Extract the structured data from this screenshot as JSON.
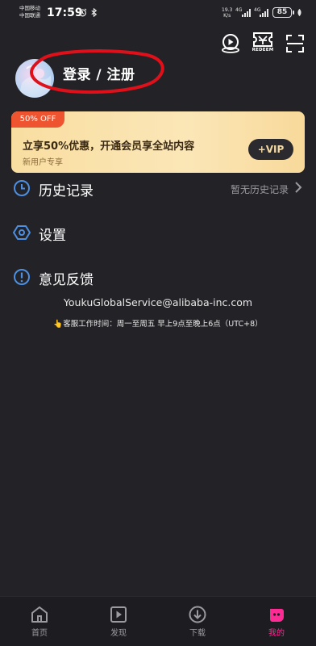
{
  "status_bar": {
    "carrier_1": "中国移动",
    "carrier_2": "中国联通",
    "time": "17:59",
    "net_speed_value": "19.3",
    "net_speed_unit": "K/s",
    "net_type_1": "4G",
    "net_type_2": "4G",
    "battery": "85"
  },
  "header": {
    "redeem_label": "REDEEM"
  },
  "profile": {
    "login_title": "登录 / 注册"
  },
  "vip_banner": {
    "badge": "50% OFF",
    "title": "立享50%优惠，开通会员享全站内容",
    "subtitle": "新用户专享",
    "button": "+VIP"
  },
  "menu": {
    "history_label": "历史记录",
    "history_right": "暂无历史记录",
    "settings_label": "设置",
    "feedback_label": "意见反馈"
  },
  "contact": {
    "email": "YoukuGlobalService@alibaba-inc.com",
    "hours": "👆客服工作时间：周一至周五 早上9点至晚上6点（UTC+8）"
  },
  "bottom_nav": {
    "items": [
      {
        "label": "首页",
        "icon": "home-icon"
      },
      {
        "label": "发现",
        "icon": "discover-icon"
      },
      {
        "label": "下载",
        "icon": "download-icon"
      },
      {
        "label": "我的",
        "icon": "profile-icon",
        "active": true
      }
    ]
  },
  "colors": {
    "background": "#232327",
    "accent_pink": "#ff2b94",
    "badge_red": "#ee5430",
    "banner_gold": "#f9dea1",
    "annotation_red": "#e0101a",
    "icon_blue": "#4d8fe0"
  }
}
